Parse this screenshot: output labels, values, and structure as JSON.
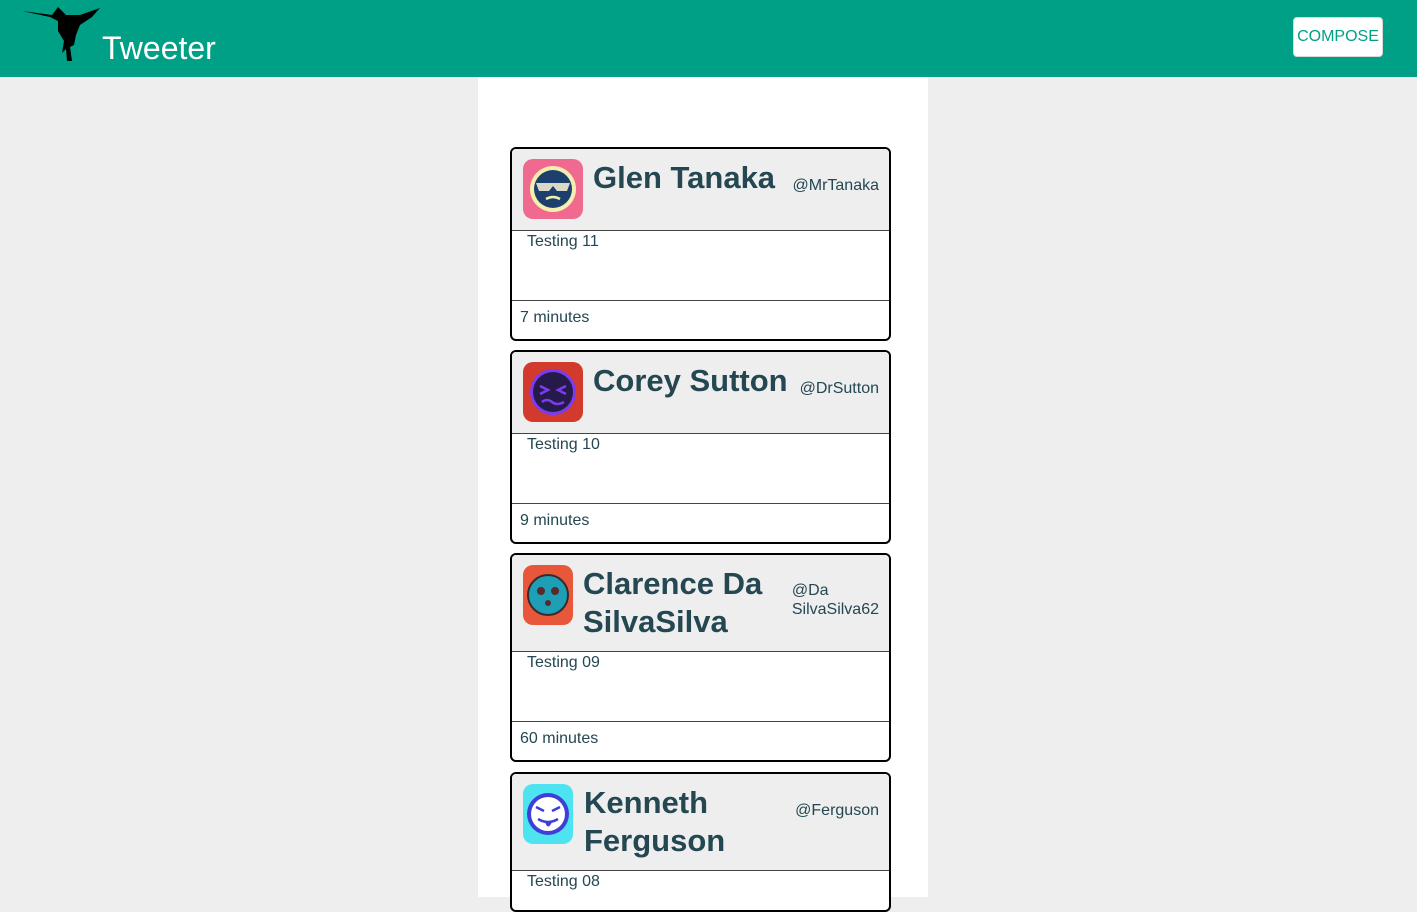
{
  "nav": {
    "brand": "Tweeter",
    "compose_label": "COMPOSE"
  },
  "colors": {
    "nav_bg": "#00a087",
    "page_bg": "#eeeeee",
    "text": "#244751"
  },
  "tweets": [
    {
      "name": "Glen Tanaka",
      "handle": "@MrTanaka",
      "text": "Testing 11",
      "time": "7 minutes",
      "avatar_icon": "sunglasses-face-icon",
      "avatar_bg": "#f06a8f"
    },
    {
      "name": "Corey Sutton",
      "handle": "@DrSutton",
      "text": "Testing 10",
      "time": "9 minutes",
      "avatar_icon": "squint-face-icon",
      "avatar_bg": "#d23a2e"
    },
    {
      "name_line1": "Clarence Da",
      "name_line2": "SilvaSilva",
      "handle_line1": "@Da",
      "handle_line2": "SilvaSilva62",
      "text": "Testing 09",
      "time": "60 minutes",
      "avatar_icon": "skull-face-icon",
      "avatar_bg": "#e8573a"
    },
    {
      "name_line1": "Kenneth",
      "name_line2": "Ferguson",
      "handle": "@Ferguson",
      "text": "Testing 08",
      "avatar_icon": "devil-tongue-face-icon",
      "avatar_bg": "#4de3f0"
    }
  ]
}
